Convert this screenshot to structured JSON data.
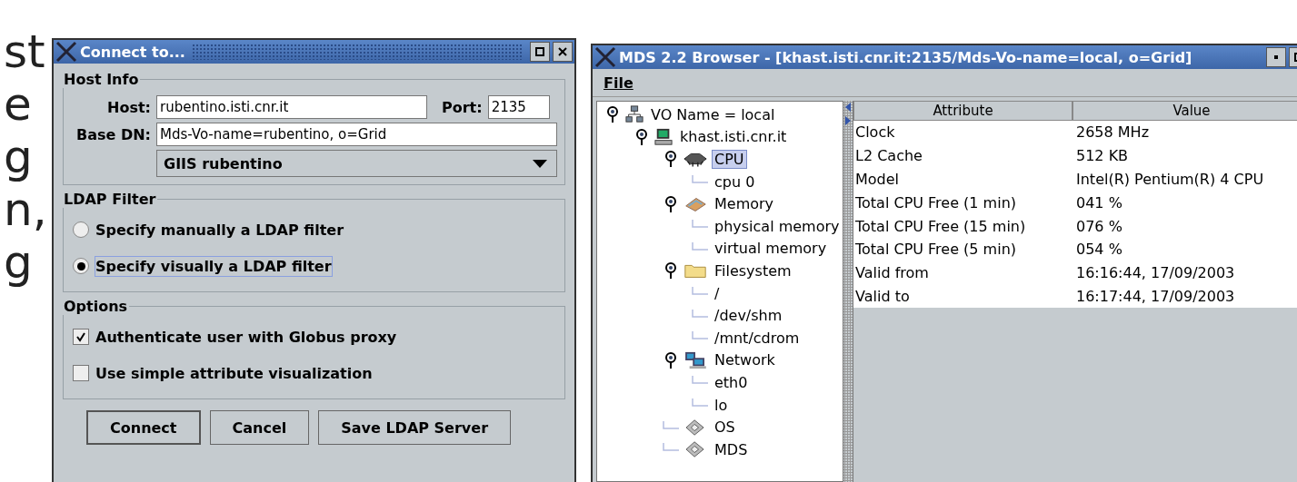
{
  "page_text": [
    "st",
    "e",
    "g",
    "n,",
    "g"
  ],
  "connect_dialog": {
    "title": "Connect to...",
    "host_info": {
      "legend": "Host Info",
      "host_label": "Host:",
      "host_value": "rubentino.isti.cnr.it",
      "port_label": "Port:",
      "port_value": "2135",
      "base_dn_label": "Base DN:",
      "base_dn_value": "Mds-Vo-name=rubentino, o=Grid",
      "giis_dropdown": "GIIS rubentino"
    },
    "ldap_filter": {
      "legend": "LDAP Filter",
      "options": [
        {
          "label": "Specify manually a LDAP filter",
          "selected": false
        },
        {
          "label": "Specify visually a LDAP filter",
          "selected": true
        }
      ]
    },
    "options": {
      "legend": "Options",
      "checkboxes": [
        {
          "label": "Authenticate user with Globus proxy",
          "checked": true
        },
        {
          "label": "Use simple attribute visualization",
          "checked": false
        }
      ]
    },
    "buttons": [
      "Connect",
      "Cancel",
      "Save LDAP Server"
    ]
  },
  "browser": {
    "title": "MDS 2.2 Browser - [khast.isti.cnr.it:2135/Mds-Vo-name=local, o=Grid]",
    "menu": [
      "File"
    ],
    "tree": [
      {
        "label": "VO Name = local",
        "kind": "network",
        "expanded": true,
        "selected": false,
        "children": [
          {
            "label": "khast.isti.cnr.it",
            "kind": "computer",
            "expanded": true,
            "selected": false,
            "children": [
              {
                "label": "CPU",
                "kind": "chip",
                "expanded": true,
                "selected": true,
                "children": [
                  {
                    "label": "cpu 0",
                    "selected": false
                  }
                ]
              },
              {
                "label": "Memory",
                "kind": "memory",
                "expanded": true,
                "selected": false,
                "children": [
                  {
                    "label": "physical memory",
                    "selected": false
                  },
                  {
                    "label": "virtual memory",
                    "selected": false
                  }
                ]
              },
              {
                "label": "Filesystem",
                "kind": "folder",
                "expanded": true,
                "selected": false,
                "children": [
                  {
                    "label": "/",
                    "selected": false
                  },
                  {
                    "label": "/dev/shm",
                    "selected": false
                  },
                  {
                    "label": "/mnt/cdrom",
                    "selected": false
                  }
                ]
              },
              {
                "label": "Network",
                "kind": "hosts",
                "expanded": true,
                "selected": false,
                "children": [
                  {
                    "label": "eth0",
                    "selected": false
                  },
                  {
                    "label": "lo",
                    "selected": false
                  }
                ]
              },
              {
                "label": "OS",
                "kind": "disk",
                "selected": false
              },
              {
                "label": "MDS",
                "kind": "disk",
                "selected": false
              }
            ]
          }
        ]
      }
    ],
    "table": {
      "columns": [
        "Attribute",
        "Value"
      ],
      "rows": [
        [
          "Clock",
          "2658 MHz"
        ],
        [
          "L2 Cache",
          "512 KB"
        ],
        [
          "Model",
          "Intel(R) Pentium(R) 4 CPU"
        ],
        [
          "Total CPU Free (1 min)",
          "041 %"
        ],
        [
          "Total CPU Free (15 min)",
          "076 %"
        ],
        [
          "Total CPU Free (5 min)",
          "054 %"
        ],
        [
          "Valid from",
          "16:16:44, 17/09/2003"
        ],
        [
          "Valid to",
          "16:17:44, 17/09/2003"
        ]
      ]
    }
  }
}
